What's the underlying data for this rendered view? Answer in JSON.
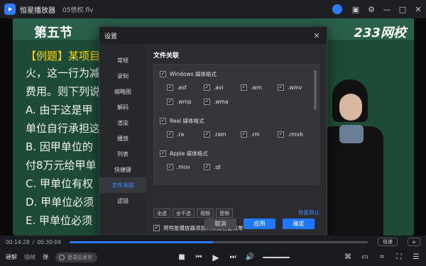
{
  "titlebar": {
    "app_name": "恒星播放器",
    "file_name": "05债权.flv",
    "buttons": [
      "user",
      "screen",
      "settings",
      "minimize",
      "maximize",
      "close"
    ]
  },
  "video": {
    "section_title": "第五节",
    "brand": "233网校",
    "lines": [
      {
        "text": "【例题】某项目",
        "color": "yellow"
      },
      {
        "text": "火，这一行为减"
      },
      {
        "text": "费用。则下列说"
      },
      {
        "text": "A. 由于这是甲"
      },
      {
        "text": "单位自行承担这"
      },
      {
        "text": "B. 因甲单位的"
      },
      {
        "text": "付8万元给甲单"
      },
      {
        "text": "C. 甲单位有权"
      },
      {
        "text": "D. 甲单位必须"
      },
      {
        "text": "E. 甲单位必须"
      }
    ]
  },
  "settings_dialog": {
    "title": "设置",
    "nav_items": [
      "常规",
      "录制",
      "缩略图",
      "解码",
      "渲染",
      "播放",
      "列表",
      "快捷键",
      "文件关联",
      "滤镜"
    ],
    "active_nav": "文件关联",
    "content_title": "文件关联",
    "groups": [
      {
        "label": "Windows 媒体格式",
        "items": [
          ".asf",
          ".avi",
          ".wm",
          ".wmv",
          ".wmp",
          ".wma"
        ]
      },
      {
        "label": "Real 媒体格式",
        "items": [
          ".ra",
          ".ram",
          ".rm",
          ".rmvb"
        ]
      },
      {
        "label": "Apple 媒体格式",
        "items": [
          ".mov",
          ".qt"
        ]
      }
    ],
    "quick_buttons": [
      "全选",
      "全不选",
      "视频",
      "音频"
    ],
    "restore_default": "恢复默认",
    "context_menu_option": "将恒星播放器添加到系统右键菜单",
    "footer_buttons": {
      "cancel": "取消",
      "apply": "应用",
      "ok": "确定"
    }
  },
  "player": {
    "time_current": "00:14:28",
    "time_total": "00:30:04",
    "progress": 0.48,
    "speed_label": "倍速",
    "speed_extra": "+",
    "left_controls": {
      "hd": "硬解",
      "plugin": "插帧",
      "danmaku": "弹",
      "danmaku_pill": "登录后发言"
    }
  }
}
